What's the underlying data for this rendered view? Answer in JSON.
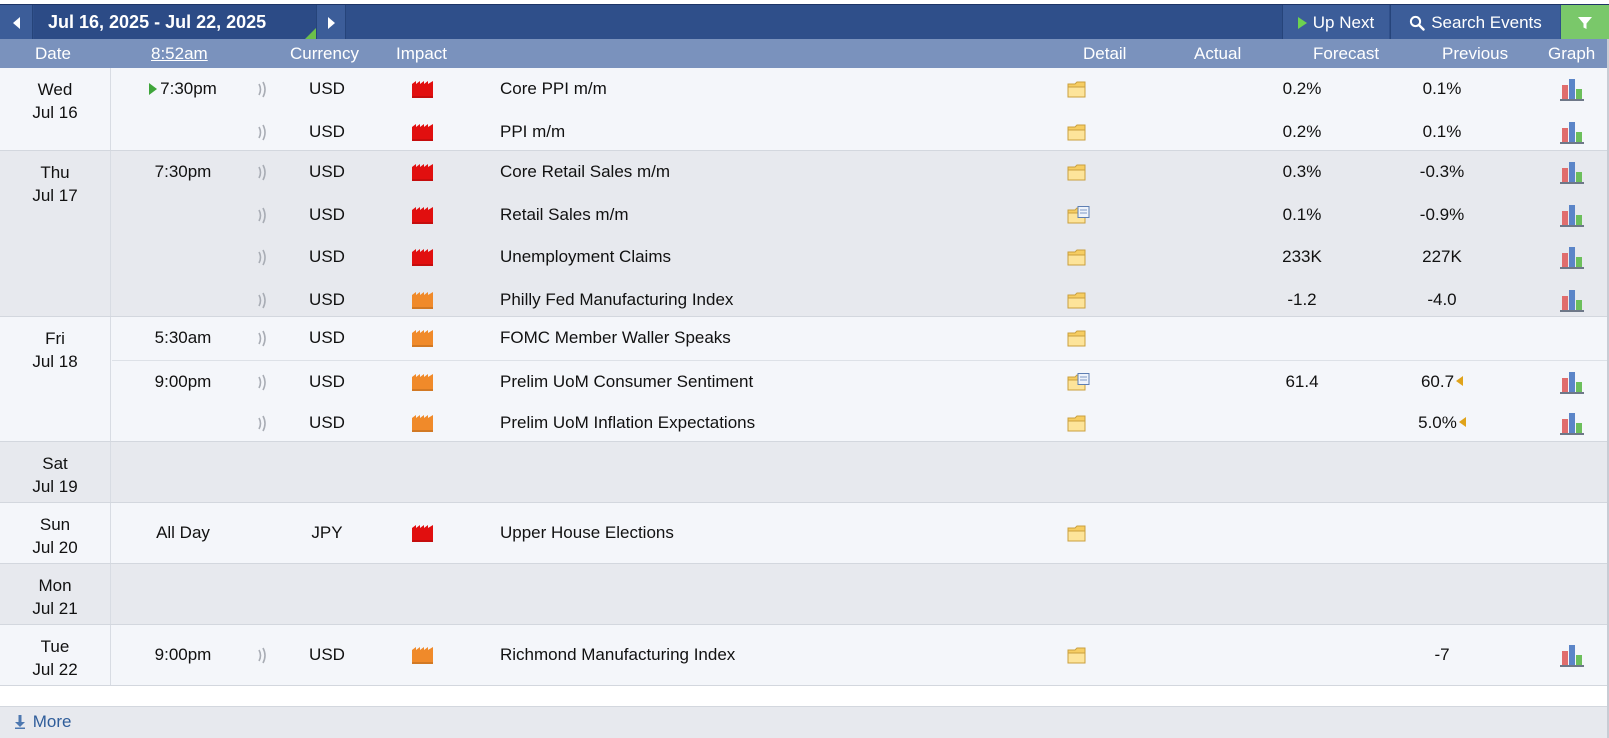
{
  "toolbar": {
    "date_range": "Jul 16, 2025 - Jul 22, 2025",
    "up_next_label": "Up Next",
    "search_label": "Search Events"
  },
  "header": {
    "date": "Date",
    "time": "8:52am",
    "currency": "Currency",
    "impact": "Impact",
    "detail": "Detail",
    "actual": "Actual",
    "forecast": "Forecast",
    "previous": "Previous",
    "graph": "Graph"
  },
  "colors": {
    "high_impact": "#e10f0f",
    "medium_impact": "#f08a2a",
    "topbar": "#2f4f8a",
    "header": "#7a92bd",
    "accent_green": "#6cc04a"
  },
  "days": [
    {
      "day": "Wed",
      "date": "Jul 16",
      "events": [
        {
          "time": "7:30pm",
          "current": true,
          "currency": "USD",
          "impact": "high",
          "event": "Core PPI m/m",
          "detail": "folder",
          "actual": "",
          "forecast": "0.2%",
          "previous": "0.1%",
          "revised": false,
          "graph": true
        },
        {
          "time": "",
          "currency": "USD",
          "impact": "high",
          "event": "PPI m/m",
          "detail": "folder",
          "actual": "",
          "forecast": "0.2%",
          "previous": "0.1%",
          "revised": false,
          "graph": true
        }
      ]
    },
    {
      "day": "Thu",
      "date": "Jul 17",
      "events": [
        {
          "time": "7:30pm",
          "currency": "USD",
          "impact": "high",
          "event": "Core Retail Sales m/m",
          "detail": "folder",
          "actual": "",
          "forecast": "0.3%",
          "previous": "-0.3%",
          "revised": false,
          "graph": true
        },
        {
          "time": "",
          "currency": "USD",
          "impact": "high",
          "event": "Retail Sales m/m",
          "detail": "folder-doc",
          "actual": "",
          "forecast": "0.1%",
          "previous": "-0.9%",
          "revised": false,
          "graph": true
        },
        {
          "time": "",
          "currency": "USD",
          "impact": "high",
          "event": "Unemployment Claims",
          "detail": "folder",
          "actual": "",
          "forecast": "233K",
          "previous": "227K",
          "revised": false,
          "graph": true
        },
        {
          "time": "",
          "currency": "USD",
          "impact": "medium",
          "event": "Philly Fed Manufacturing Index",
          "detail": "folder",
          "actual": "",
          "forecast": "-1.2",
          "previous": "-4.0",
          "revised": false,
          "graph": true
        }
      ]
    },
    {
      "day": "Fri",
      "date": "Jul 18",
      "events": [
        {
          "time": "5:30am",
          "currency": "USD",
          "impact": "medium",
          "event": "FOMC Member Waller Speaks",
          "detail": "folder",
          "actual": "",
          "forecast": "",
          "previous": "",
          "revised": false,
          "graph": false
        },
        {
          "time": "9:00pm",
          "separator": true,
          "currency": "USD",
          "impact": "medium",
          "event": "Prelim UoM Consumer Sentiment",
          "detail": "folder-doc",
          "actual": "",
          "forecast": "61.4",
          "previous": "60.7",
          "revised": true,
          "graph": true
        },
        {
          "time": "",
          "currency": "USD",
          "impact": "medium",
          "event": "Prelim UoM Inflation Expectations",
          "detail": "folder",
          "actual": "",
          "forecast": "",
          "previous": "5.0%",
          "revised": true,
          "graph": true
        }
      ]
    },
    {
      "day": "Sat",
      "date": "Jul 19",
      "events": []
    },
    {
      "day": "Sun",
      "date": "Jul 20",
      "events": [
        {
          "time": "All Day",
          "currency": "JPY",
          "impact": "high",
          "event": "Upper House Elections",
          "detail": "folder",
          "actual": "",
          "forecast": "",
          "previous": "",
          "revised": false,
          "graph": false,
          "no_sound": true
        }
      ]
    },
    {
      "day": "Mon",
      "date": "Jul 21",
      "events": []
    },
    {
      "day": "Tue",
      "date": "Jul 22",
      "events": [
        {
          "time": "9:00pm",
          "currency": "USD",
          "impact": "medium",
          "event": "Richmond Manufacturing Index",
          "detail": "folder",
          "actual": "",
          "forecast": "",
          "previous": "-7",
          "revised": false,
          "graph": true
        }
      ]
    }
  ],
  "footer": {
    "more_label": "More"
  }
}
